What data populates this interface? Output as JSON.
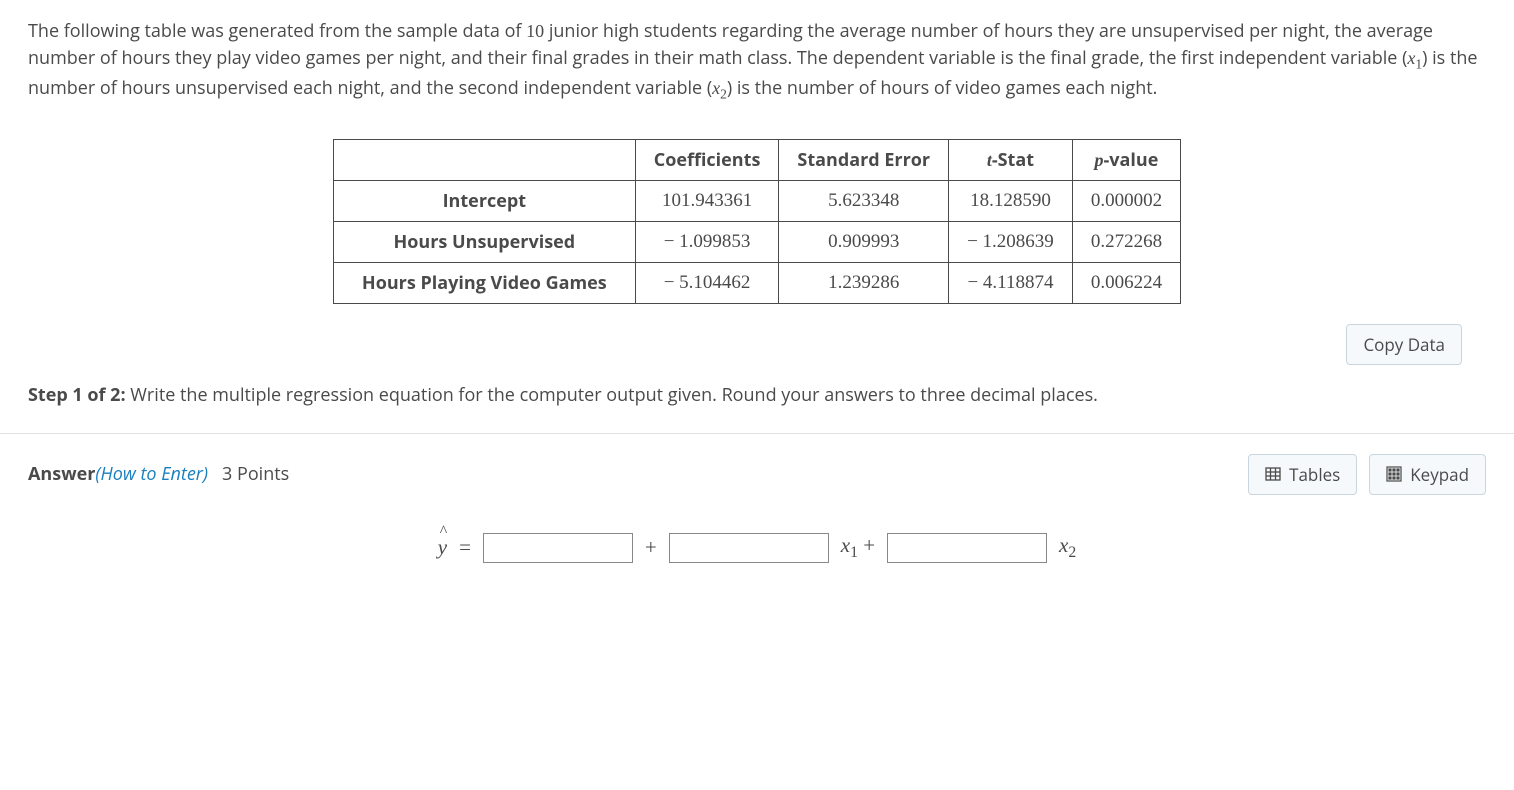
{
  "problem": {
    "text_a": "The following table was generated from the sample data of ",
    "n": "10",
    "text_b": " junior high students regarding the average number of hours they are unsupervised per night, the average number of hours they play video games per night, and their final grades in their math class. The dependent variable is the final grade, the first independent variable (",
    "x1_var": "x",
    "x1_sub": "1",
    "text_c": ") is the number of hours unsupervised each night, and the second independent variable (",
    "x2_var": "x",
    "x2_sub": "2",
    "text_d": ") is the number of hours of video games each night."
  },
  "table": {
    "headers": {
      "coeff": "Coefficients",
      "se": "Standard Error",
      "tstat_t": "t",
      "tstat_rest": "-Stat",
      "p": "p",
      "p_rest": "-value"
    },
    "rows": [
      {
        "label": "Intercept",
        "coeff": "101.943361",
        "se": "5.623348",
        "t": "18.128590",
        "p": "0.000002"
      },
      {
        "label": "Hours Unsupervised",
        "coeff": "− 1.099853",
        "se": "0.909993",
        "t": "− 1.208639",
        "p": "0.272268"
      },
      {
        "label": "Hours Playing Video Games",
        "coeff": "− 5.104462",
        "se": "1.239286",
        "t": "− 4.118874",
        "p": "0.006224"
      }
    ]
  },
  "buttons": {
    "copy": "Copy Data",
    "tables": "Tables",
    "keypad": "Keypad"
  },
  "step": {
    "label": "Step 1 of 2:",
    "text": " Write the multiple regression equation for the computer output given. Round your answers to three decimal places."
  },
  "answer": {
    "label": "Answer",
    "how": "(How to Enter)",
    "points": "3 Points"
  },
  "equation": {
    "yhat": "y",
    "equals": " = ",
    "plus": "+",
    "x1": "x",
    "x1s": "1",
    "x2": "x",
    "x2s": "2"
  }
}
